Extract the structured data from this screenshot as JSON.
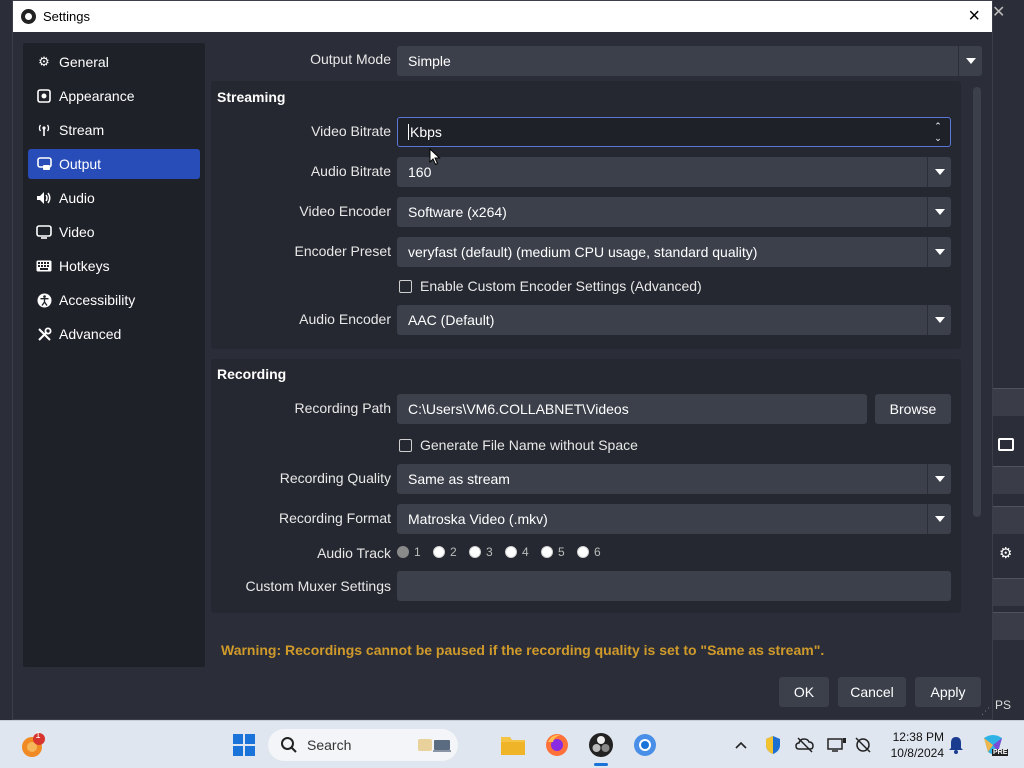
{
  "window": {
    "title": "Settings",
    "close_glyph": "×",
    "bg_close_glyph": "✕"
  },
  "sidebar": {
    "items": [
      {
        "label": "General",
        "icon": "gear-icon",
        "glyph": "⚙"
      },
      {
        "label": "Appearance",
        "icon": "appearance-icon",
        "glyph": "▣"
      },
      {
        "label": "Stream",
        "icon": "antenna-icon",
        "glyph": "((•))"
      },
      {
        "label": "Output",
        "icon": "output-icon",
        "glyph": "⊡",
        "active": true
      },
      {
        "label": "Audio",
        "icon": "speaker-icon",
        "glyph": "🔈"
      },
      {
        "label": "Video",
        "icon": "monitor-icon",
        "glyph": "▭"
      },
      {
        "label": "Hotkeys",
        "icon": "keyboard-icon",
        "glyph": "⌨"
      },
      {
        "label": "Accessibility",
        "icon": "accessibility-icon",
        "glyph": "♿"
      },
      {
        "label": "Advanced",
        "icon": "tools-icon",
        "glyph": "✕"
      }
    ]
  },
  "output_mode": {
    "label": "Output Mode",
    "value": "Simple"
  },
  "streaming": {
    "title": "Streaming",
    "video_bitrate": {
      "label": "Video Bitrate",
      "value": "Kbps",
      "up": "⌃",
      "down": "⌄"
    },
    "audio_bitrate": {
      "label": "Audio Bitrate",
      "value": "160"
    },
    "video_encoder": {
      "label": "Video Encoder",
      "value": "Software (x264)"
    },
    "encoder_preset": {
      "label": "Encoder Preset",
      "value": "veryfast (default) (medium CPU usage, standard quality)"
    },
    "custom_encoder": {
      "label": "Enable Custom Encoder Settings (Advanced)",
      "checked": false
    },
    "audio_encoder": {
      "label": "Audio Encoder",
      "value": "AAC (Default)"
    }
  },
  "recording": {
    "title": "Recording",
    "path": {
      "label": "Recording Path",
      "value": "C:\\Users\\VM6.COLLABNET\\Videos",
      "browse": "Browse"
    },
    "no_space": {
      "label": "Generate File Name without Space",
      "checked": false
    },
    "quality": {
      "label": "Recording Quality",
      "value": "Same as stream"
    },
    "format": {
      "label": "Recording Format",
      "value": "Matroska Video (.mkv)"
    },
    "audio_track": {
      "label": "Audio Track",
      "tracks": [
        "1",
        "2",
        "3",
        "4",
        "5",
        "6"
      ],
      "selected": "1"
    },
    "muxer": {
      "label": "Custom Muxer Settings",
      "value": ""
    }
  },
  "warning": "Warning: Recordings cannot be paused if the recording quality is set to \"Same as stream\".",
  "buttons": {
    "ok": "OK",
    "cancel": "Cancel",
    "apply": "Apply"
  },
  "bg_right_text": "PS",
  "taskbar": {
    "search_placeholder": "Search",
    "time": "12:38 PM",
    "date": "10/8/2024",
    "notification_count": "1",
    "copilot_badge": "PRE"
  },
  "colors": {
    "accent": "#284cb8",
    "warning": "#d09a2b",
    "dialog_bg": "#2b2e38",
    "input_bg": "#3c404b"
  }
}
